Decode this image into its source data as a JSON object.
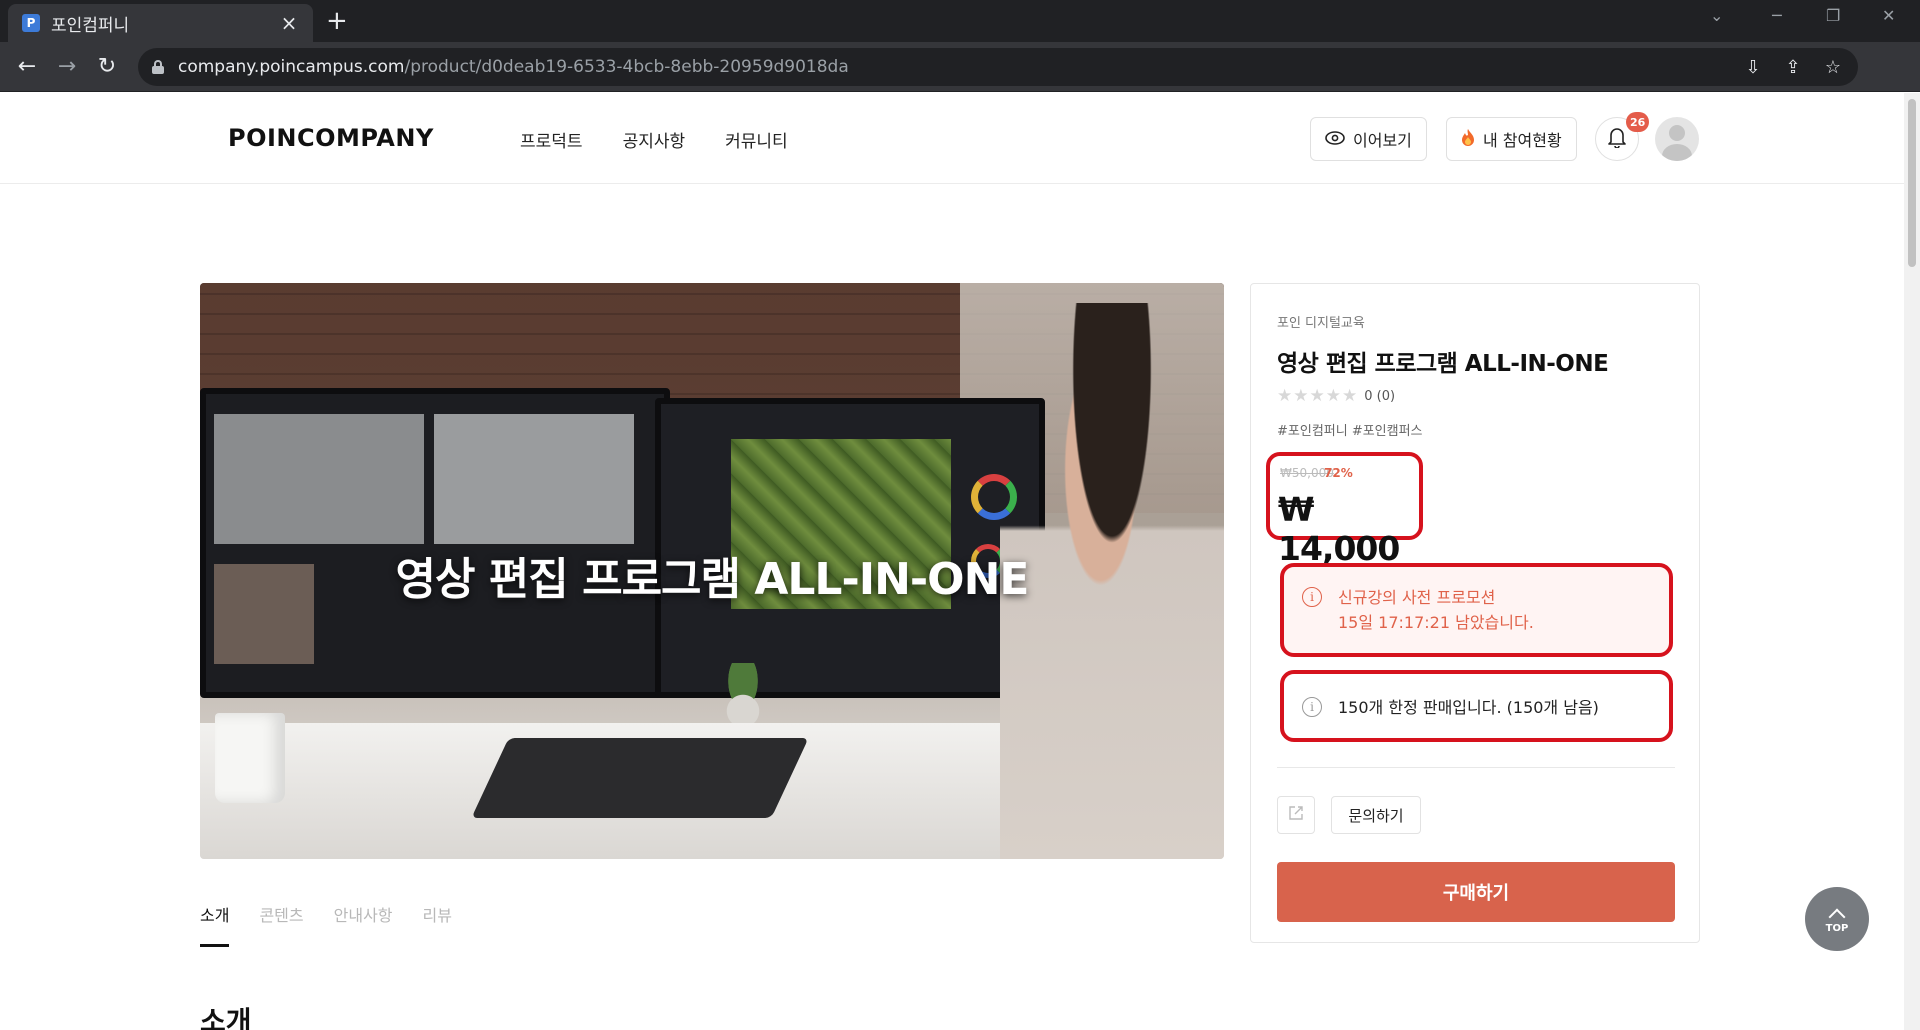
{
  "browser": {
    "tab_title": "포인컴퍼니",
    "favicon_letter": "P",
    "url_host": "company.poincampus.com",
    "url_path": "/product/d0deab19-6533-4bcb-8ebb-20959d9018da"
  },
  "header": {
    "logo": "POINCOMPANY",
    "nav": [
      "프로덕트",
      "공지사항",
      "커뮤니티"
    ],
    "continue_label": "이어보기",
    "participation_label": "내 참여현황",
    "notification_count": "26"
  },
  "hero": {
    "overlay_title": "영상 편집 프로그램 ALL-IN-ONE"
  },
  "content_tabs": [
    "소개",
    "콘텐츠",
    "안내사항",
    "리뷰"
  ],
  "section_title": "소개",
  "product": {
    "brand": "포인 디지털교육",
    "title": "영상 편집 프로그램 ALL-IN-ONE",
    "rating_text": "0 (0)",
    "star_count": 5,
    "tags": "#포인컴퍼니 #포인캠퍼스",
    "original_price": "₩50,000",
    "discount": "72%",
    "price": "₩ 14,000",
    "promo_line1": "신규강의 사전 프로모션",
    "promo_line2": "15일 17:17:21 남았습니다.",
    "limit_text": "150개 한정 판매입니다. (150개 남음)",
    "ask_label": "문의하기",
    "buy_label": "구매하기"
  },
  "top_button_label": "TOP",
  "colors": {
    "accent": "#d8634c",
    "highlight_border": "#d6121d",
    "promo_text": "#e0624a",
    "badge": "#e45c4a"
  }
}
